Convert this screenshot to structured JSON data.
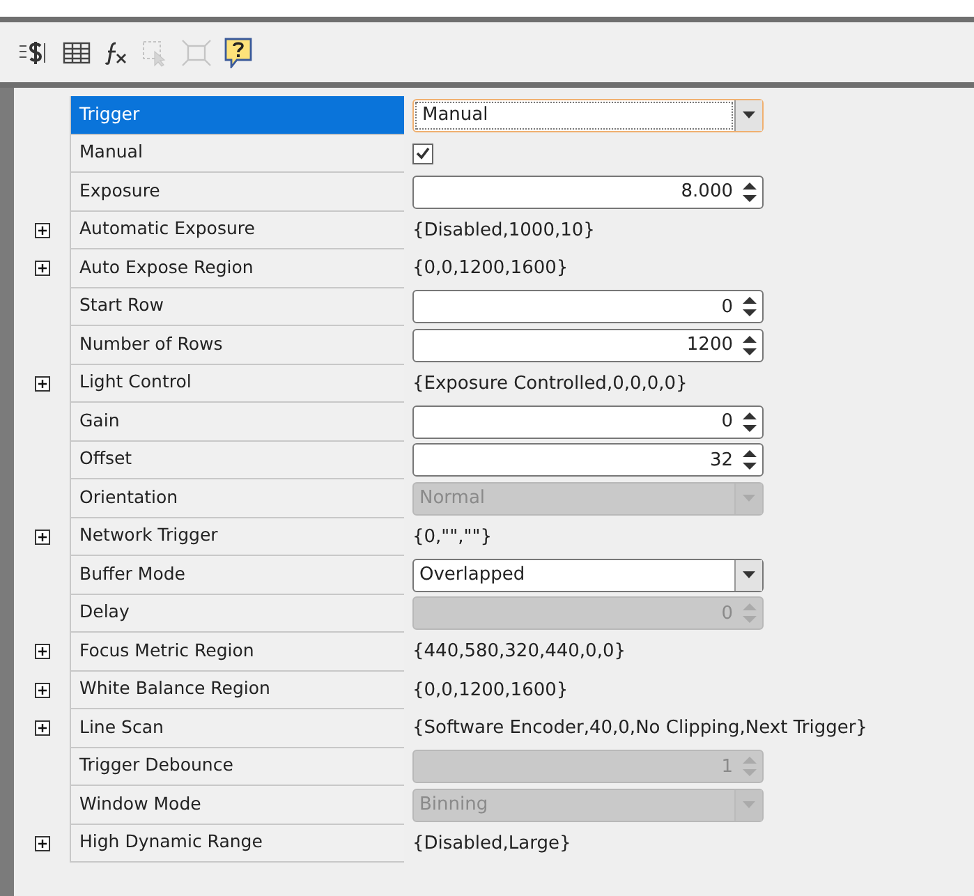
{
  "toolbar": [
    {
      "kind": "dollar",
      "disabled": false
    },
    {
      "kind": "grid",
      "disabled": false
    },
    {
      "kind": "fx",
      "disabled": false
    },
    {
      "kind": "select",
      "disabled": true
    },
    {
      "kind": "fit",
      "disabled": true
    },
    {
      "kind": "help",
      "disabled": false
    }
  ],
  "properties": [
    {
      "label": "Trigger",
      "expandable": false,
      "selected": true,
      "kind": "combo",
      "value": "Manual",
      "disabled": false,
      "focused": true
    },
    {
      "label": "Manual",
      "expandable": false,
      "selected": false,
      "kind": "checkbox",
      "checked": true
    },
    {
      "label": "Exposure",
      "expandable": false,
      "selected": false,
      "kind": "spin",
      "value": "8.000",
      "disabled": false
    },
    {
      "label": "Automatic Exposure",
      "expandable": true,
      "selected": false,
      "kind": "text",
      "value": "{Disabled,1000,10}"
    },
    {
      "label": "Auto Expose Region",
      "expandable": true,
      "selected": false,
      "kind": "text",
      "value": "{0,0,1200,1600}"
    },
    {
      "label": "Start Row",
      "expandable": false,
      "selected": false,
      "kind": "spin",
      "value": "0",
      "disabled": false
    },
    {
      "label": "Number of Rows",
      "expandable": false,
      "selected": false,
      "kind": "spin",
      "value": "1200",
      "disabled": false
    },
    {
      "label": "Light Control",
      "expandable": true,
      "selected": false,
      "kind": "text",
      "value": "{Exposure Controlled,0,0,0,0}"
    },
    {
      "label": "Gain",
      "expandable": false,
      "selected": false,
      "kind": "spin",
      "value": "0",
      "disabled": false
    },
    {
      "label": "Offset",
      "expandable": false,
      "selected": false,
      "kind": "spin",
      "value": "32",
      "disabled": false
    },
    {
      "label": "Orientation",
      "expandable": false,
      "selected": false,
      "kind": "combo",
      "value": "Normal",
      "disabled": true,
      "focused": false
    },
    {
      "label": "Network Trigger",
      "expandable": true,
      "selected": false,
      "kind": "text",
      "value": "{0,\"\",\"\"}"
    },
    {
      "label": "Buffer Mode",
      "expandable": false,
      "selected": false,
      "kind": "combo",
      "value": "Overlapped",
      "disabled": false,
      "focused": false
    },
    {
      "label": "Delay",
      "expandable": false,
      "selected": false,
      "kind": "spin",
      "value": "0",
      "disabled": true
    },
    {
      "label": "Focus Metric Region",
      "expandable": true,
      "selected": false,
      "kind": "text",
      "value": "{440,580,320,440,0,0}"
    },
    {
      "label": "White Balance Region",
      "expandable": true,
      "selected": false,
      "kind": "text",
      "value": "{0,0,1200,1600}"
    },
    {
      "label": "Line Scan",
      "expandable": true,
      "selected": false,
      "kind": "text",
      "value": "{Software Encoder,40,0,No Clipping,Next Trigger}"
    },
    {
      "label": "Trigger Debounce",
      "expandable": false,
      "selected": false,
      "kind": "spin",
      "value": "1",
      "disabled": true
    },
    {
      "label": "Window Mode",
      "expandable": false,
      "selected": false,
      "kind": "combo",
      "value": "Binning",
      "disabled": true,
      "focused": false
    },
    {
      "label": "High Dynamic Range",
      "expandable": true,
      "selected": false,
      "kind": "text",
      "value": "{Disabled,Large}"
    }
  ]
}
